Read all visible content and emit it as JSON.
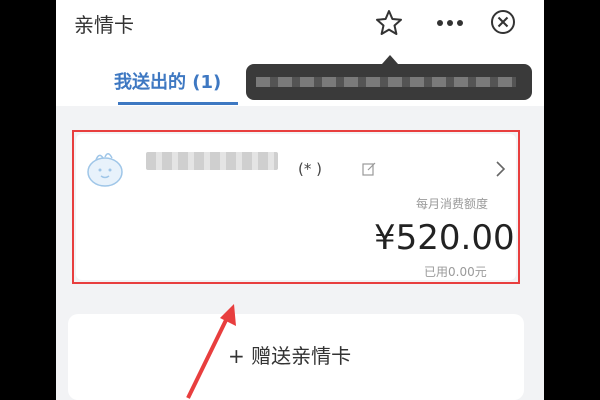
{
  "header": {
    "title": "亲情卡"
  },
  "tabs": {
    "mine_label": "我送出的 (1)"
  },
  "card": {
    "phone": "(*  )",
    "quota_label": "每月消费额度",
    "amount": "¥520.00",
    "used": "已用0.00元"
  },
  "gift_button": {
    "label": "+ 赠送亲情卡"
  },
  "colors": {
    "accent": "#3e78c2",
    "highlight": "#e83e3e",
    "background": "#f2f3f5"
  },
  "icons": [
    "star-icon",
    "more-icon",
    "close-icon",
    "edit-icon",
    "chevron-right-icon",
    "avatar-icon"
  ]
}
